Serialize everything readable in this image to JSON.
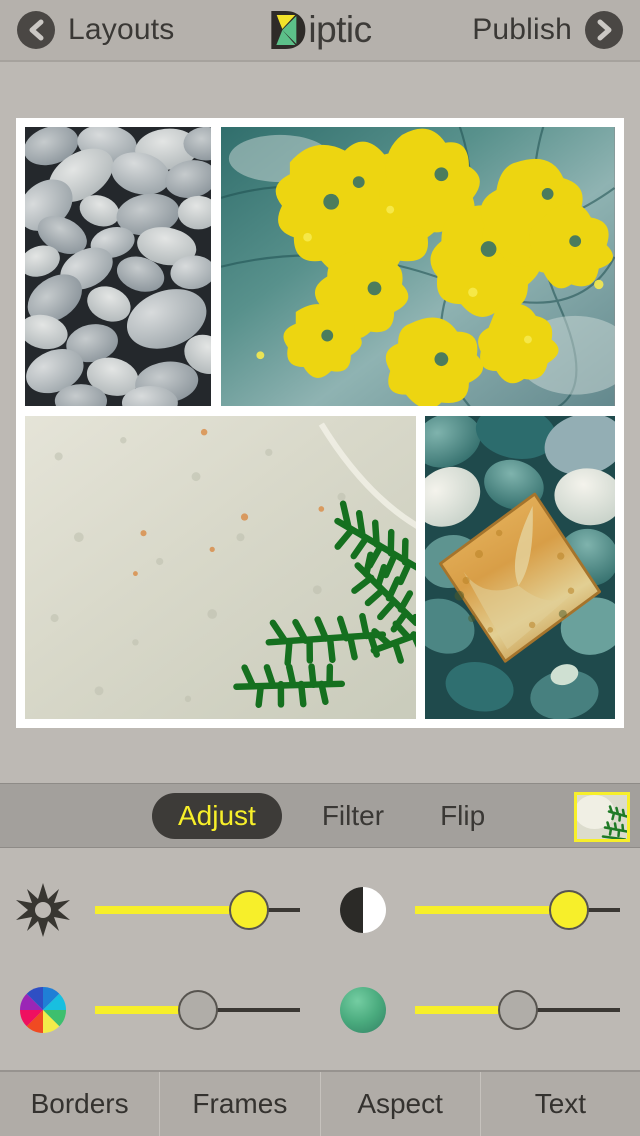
{
  "app": {
    "name": "Diptic",
    "logo_yellow": "#f2e32a",
    "logo_green": "#5cc089",
    "logo_dark": "#2e2b28",
    "accent_yellow": "#f7ef2a",
    "bar_gray": "#a3a09c",
    "page_gray": "#bdb9b4",
    "dark_chrome": "#3d3b38"
  },
  "topnav": {
    "back_icon": "chevron-left-icon",
    "back_label": "Layouts",
    "logo_icon": "diptic-logo-icon",
    "logo_text": "iptic",
    "publish_label": "Publish",
    "forward_icon": "chevron-right-icon"
  },
  "collage": {
    "layout": "4-cell-mixed",
    "border_color": "#ffffff",
    "cells": [
      {
        "id": "cell-top-left",
        "name": "gray-pebbles-photo",
        "caption": "Smooth gray beach pebbles"
      },
      {
        "id": "cell-top-right",
        "name": "yellow-lichen-photo",
        "caption": "Yellow lichen on teal rock"
      },
      {
        "id": "cell-bottom-left",
        "name": "granite-fern-photo",
        "caption": "Pale granite with green cedar fronds"
      },
      {
        "id": "cell-bottom-right",
        "name": "golden-stone-photo",
        "caption": "Golden diamond stone on teal pebbles"
      }
    ]
  },
  "tabbar": {
    "tabs": [
      {
        "label": "Adjust",
        "active": true
      },
      {
        "label": "Filter",
        "active": false
      },
      {
        "label": "Flip",
        "active": false
      }
    ],
    "selected_cell_thumbnail": "granite-fern-thumbnail",
    "thumbnail_border_color": "#f7ef2a"
  },
  "adjust": {
    "sliders": [
      {
        "name": "brightness",
        "icon": "sun-icon",
        "value": 75,
        "active": true
      },
      {
        "name": "contrast",
        "icon": "half-circle-icon",
        "value": 75,
        "active": true
      },
      {
        "name": "saturation",
        "icon": "color-wheel-icon",
        "value": 50,
        "active": false
      },
      {
        "name": "tint",
        "icon": "green-sphere-icon",
        "value": 50,
        "active": false
      }
    ]
  },
  "bottombar": {
    "items": [
      {
        "label": "Borders"
      },
      {
        "label": "Frames"
      },
      {
        "label": "Aspect"
      },
      {
        "label": "Text"
      }
    ]
  }
}
